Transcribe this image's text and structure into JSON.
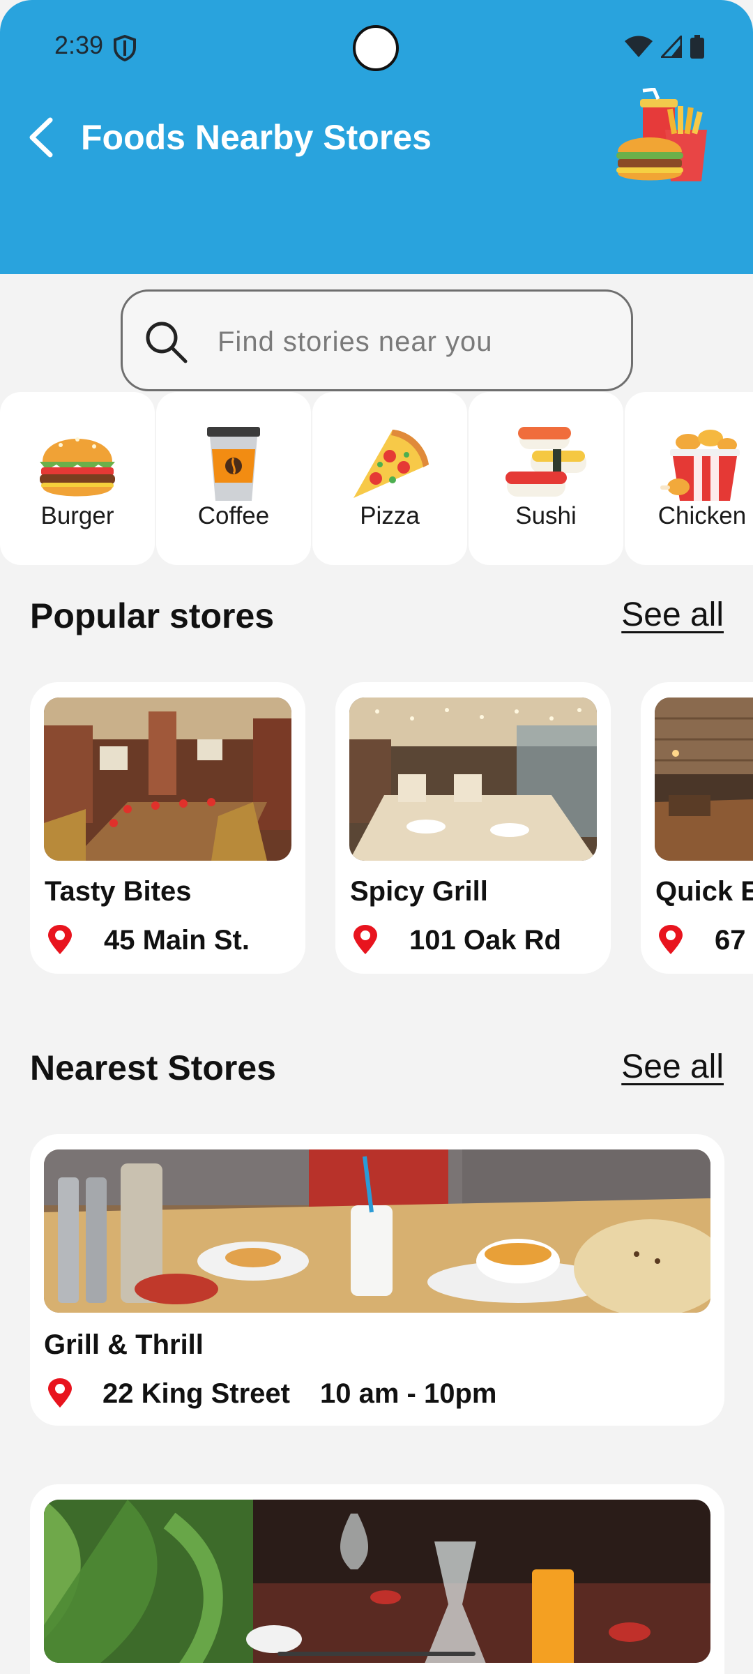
{
  "status_bar": {
    "time": "2:39"
  },
  "header": {
    "title": "Foods Nearby Stores"
  },
  "search": {
    "placeholder": "Find stories near you"
  },
  "categories": [
    {
      "label": "Burger",
      "icon": "burger-icon"
    },
    {
      "label": "Coffee",
      "icon": "coffee-cup-icon"
    },
    {
      "label": "Pizza",
      "icon": "pizza-icon"
    },
    {
      "label": "Sushi",
      "icon": "sushi-icon"
    },
    {
      "label": "Chicken",
      "icon": "chicken-bucket-icon"
    }
  ],
  "popular": {
    "title": "Popular stores",
    "see_all": "See all",
    "stores": [
      {
        "name": "Tasty Bites",
        "address": "45 Main St."
      },
      {
        "name": "Spicy Grill",
        "address": "101 Oak Rd"
      },
      {
        "name": "Quick E",
        "address": "67"
      }
    ]
  },
  "nearest": {
    "title": "Nearest Stores",
    "see_all": "See all",
    "stores": [
      {
        "name": "Grill & Thrill",
        "address": "22 King Street",
        "hours": "10 am - 10pm"
      },
      {
        "name": "",
        "address": "",
        "hours": ""
      }
    ]
  },
  "colors": {
    "header_bg": "#29a3dd",
    "pin": "#e8141e",
    "background": "#f3f3f3"
  }
}
